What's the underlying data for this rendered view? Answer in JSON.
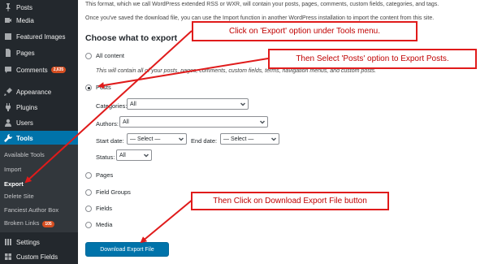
{
  "sidebar": {
    "items": [
      {
        "label": "Posts",
        "icon": "pushpin-icon"
      },
      {
        "label": "Media",
        "icon": "media-icon"
      },
      {
        "label": "Featured Images",
        "icon": "image-icon"
      },
      {
        "label": "Pages",
        "icon": "page-icon"
      },
      {
        "label": "Comments",
        "icon": "comment-icon",
        "badge": "2,635"
      },
      {
        "label": "Appearance",
        "icon": "paintbrush-icon"
      },
      {
        "label": "Plugins",
        "icon": "plugin-icon"
      },
      {
        "label": "Users",
        "icon": "users-icon"
      },
      {
        "label": "Tools",
        "icon": "wrench-icon"
      },
      {
        "label": "Settings",
        "icon": "settings-icon"
      },
      {
        "label": "Custom Fields",
        "icon": "grid-icon"
      }
    ],
    "submenu": [
      {
        "label": "Available Tools"
      },
      {
        "label": "Import"
      },
      {
        "label": "Export"
      },
      {
        "label": "Delete Site"
      },
      {
        "label": "Fanciest Author Box"
      },
      {
        "label": "Broken Links",
        "badge": "105"
      }
    ]
  },
  "main": {
    "intro_line1": "This format, which we call WordPress extended RSS or WXR, will contain your posts, pages, comments, custom fields, categories, and tags.",
    "intro_line2": "Once you've saved the download file, you can use the Import function in another WordPress installation to import the content from this site.",
    "section_title": "Choose what to export",
    "options": {
      "all_content": "All content",
      "all_content_desc": "This will contain all of your posts, pages, comments, custom fields, terms, navigation menus, and custom posts.",
      "posts": "Posts",
      "pages": "Pages",
      "field_groups": "Field Groups",
      "fields": "Fields",
      "media": "Media"
    },
    "filters": {
      "categories_label": "Categories:",
      "categories_value": "All",
      "authors_label": "Authors:",
      "authors_value": "All",
      "start_date_label": "Start date:",
      "start_date_value": "— Select —",
      "end_date_label": "End date:",
      "end_date_value": "— Select —",
      "status_label": "Status:",
      "status_value": "All"
    },
    "download_button": "Download Export File"
  },
  "annotations": {
    "callout1": "Click on 'Export' option under Tools menu.",
    "callout2": "Then Select 'Posts' option to Export Posts.",
    "callout3": "Then Click on Download Export File button"
  },
  "colors": {
    "sidebar_bg": "#23282d",
    "active_menu": "#0073aa",
    "badge": "#d54e21",
    "annotation_red": "#e01b1b",
    "button_blue": "#0073aa"
  }
}
